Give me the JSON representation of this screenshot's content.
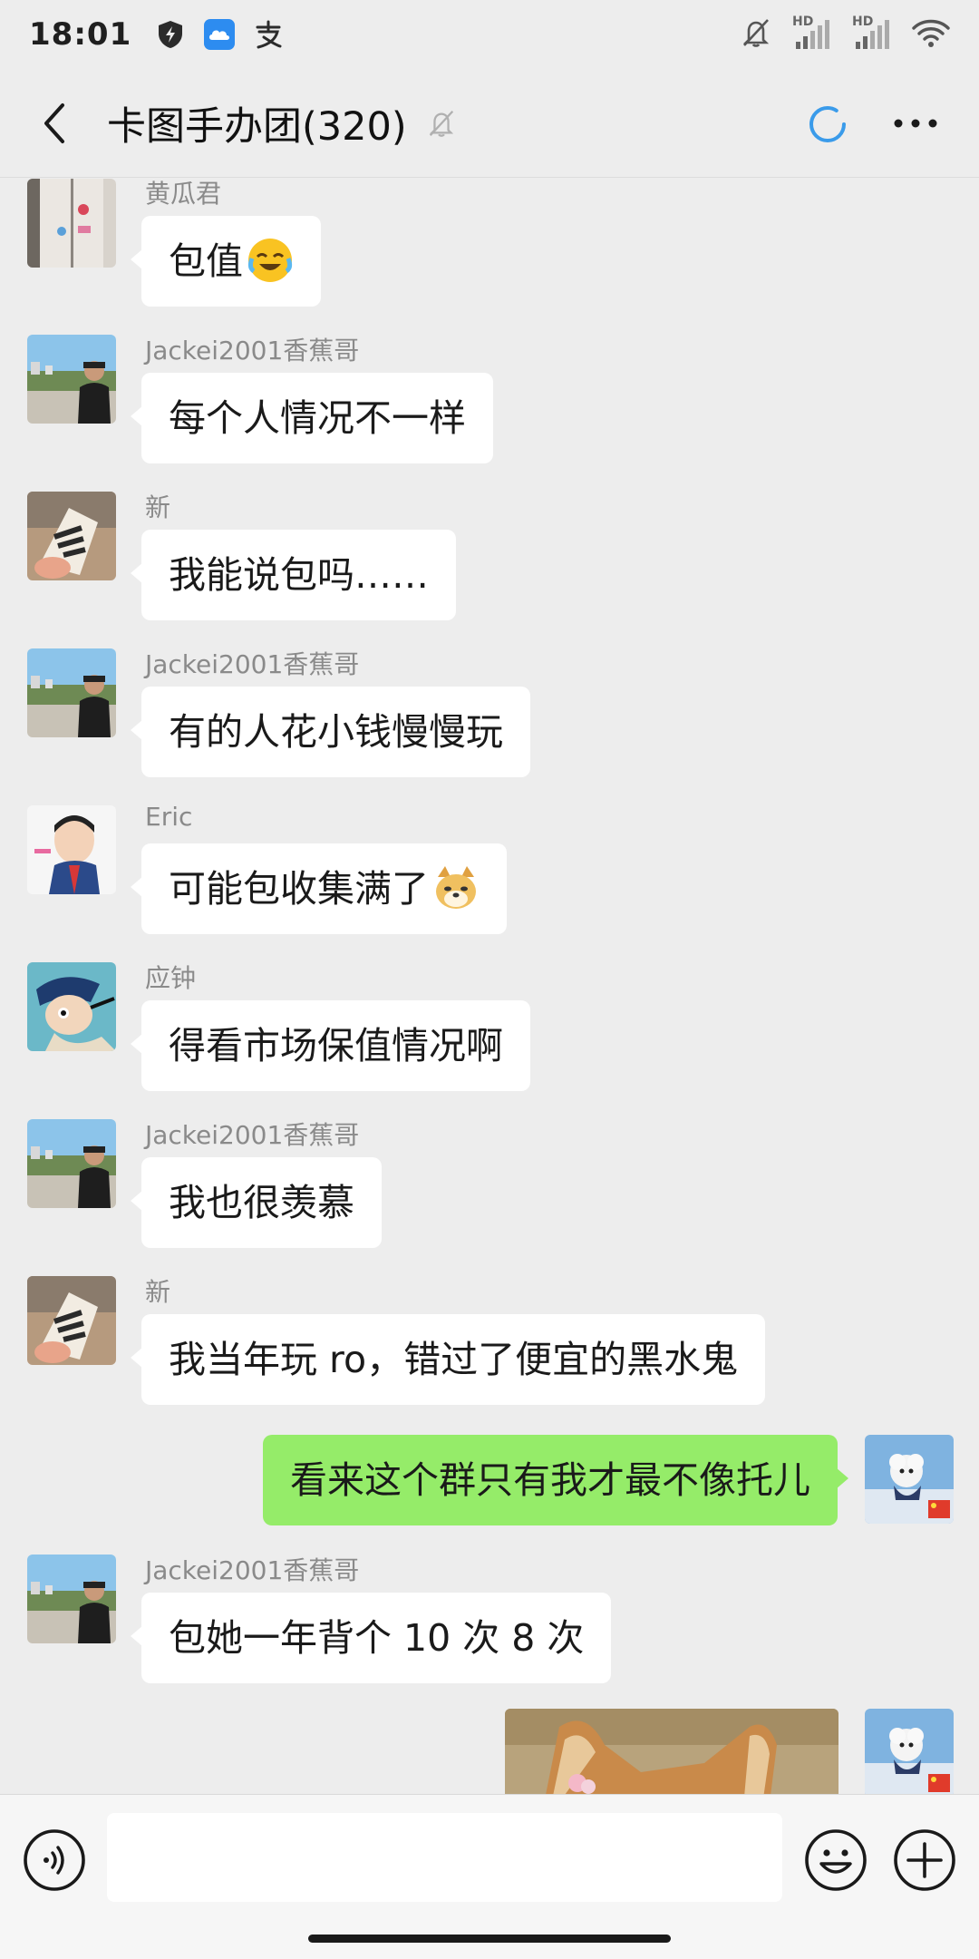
{
  "status_bar": {
    "time": "18:01",
    "left_icons": [
      "shield-bolt-icon",
      "cloud-app-icon",
      "alipay-icon"
    ],
    "right_icons": [
      "bell-off-icon",
      "signal-hd-icon",
      "signal-hd-icon",
      "wifi-icon"
    ],
    "hd_label_1": "HD",
    "hd_label_2": "HD"
  },
  "header": {
    "title": "卡图手办团(320)",
    "back_icon": "chevron-left-icon",
    "mute_icon": "bell-off-icon",
    "loading_icon": "loading-spinner-icon",
    "more_icon": "more-dots-icon"
  },
  "messages": [
    {
      "sender": "黄瓜君",
      "text": "包值",
      "emoji": "laughing-crying-emoji",
      "mine": false,
      "avatar": "avatar-fridge"
    },
    {
      "sender": "Jackei2001香蕉哥",
      "text": "每个人情况不一样",
      "mine": false,
      "avatar": "avatar-man-outdoor"
    },
    {
      "sender": "新",
      "text": "我能说包吗……",
      "mine": false,
      "avatar": "avatar-shoe"
    },
    {
      "sender": "Jackei2001香蕉哥",
      "text": "有的人花小钱慢慢玩",
      "mine": false,
      "avatar": "avatar-man-outdoor"
    },
    {
      "sender": "Eric",
      "text": "可能包收集满了",
      "emoji": "doge-emoji",
      "mine": false,
      "avatar": "avatar-cartoon-boy"
    },
    {
      "sender": "应钟",
      "text": "得看市场保值情况啊",
      "mine": false,
      "avatar": "avatar-anime"
    },
    {
      "sender": "Jackei2001香蕉哥",
      "text": "我也很羡慕",
      "mine": false,
      "avatar": "avatar-man-outdoor"
    },
    {
      "sender": "新",
      "text": "我当年玩 ro，错过了便宜的黑水鬼",
      "mine": false,
      "avatar": "avatar-shoe"
    },
    {
      "sender": "",
      "text": "看来这个群只有我才最不像托儿",
      "mine": true,
      "avatar": "avatar-white-dog"
    },
    {
      "sender": "Jackei2001香蕉哥",
      "text": "包她一年背个 10 次 8 次",
      "mine": false,
      "avatar": "avatar-man-outdoor"
    }
  ],
  "last_message": {
    "type": "image",
    "mine": true,
    "content": "dog-photo"
  },
  "input_bar": {
    "voice_icon": "voice-icon",
    "emoji_icon": "smiley-icon",
    "plus_icon": "plus-circle-icon",
    "text_value": ""
  },
  "colors": {
    "background": "#ededed",
    "bubble_other": "#ffffff",
    "bubble_mine": "#95ec69",
    "spinner": "#3a9bea"
  }
}
